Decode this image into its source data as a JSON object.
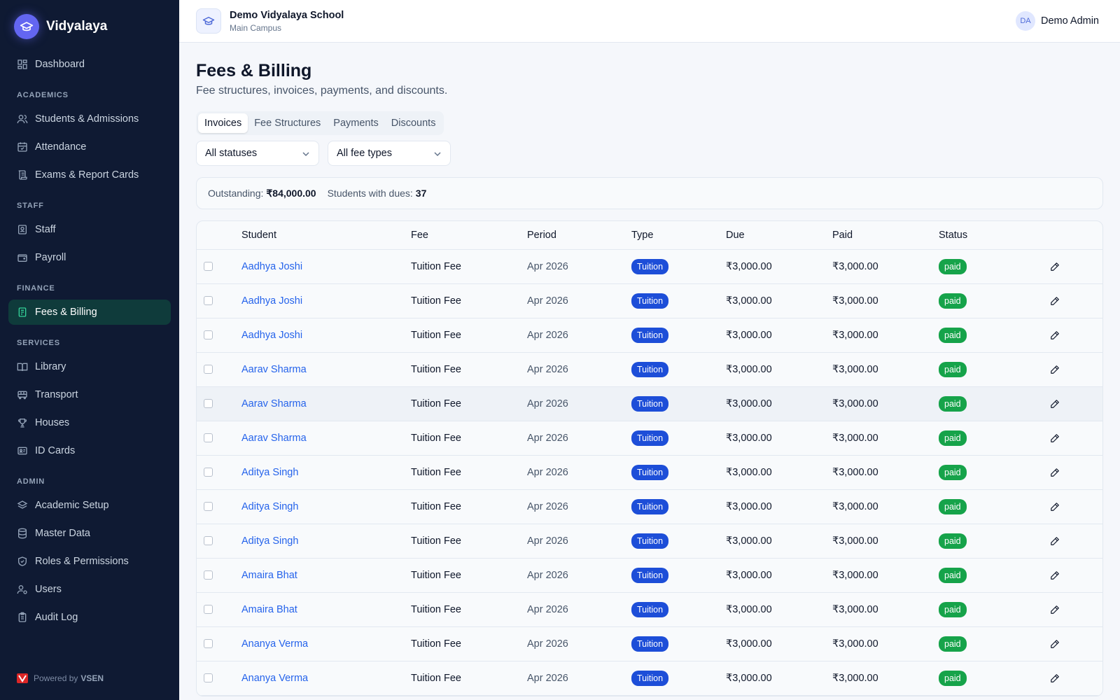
{
  "app": {
    "name": "Vidyalaya"
  },
  "sidebar": {
    "dashboard": "Dashboard",
    "sections": {
      "academics": "ACADEMICS",
      "staff": "STAFF",
      "finance": "FINANCE",
      "services": "SERVICES",
      "admin": "ADMIN"
    },
    "items": {
      "students": "Students & Admissions",
      "attendance": "Attendance",
      "exams": "Exams & Report Cards",
      "staff": "Staff",
      "payroll": "Payroll",
      "fees": "Fees & Billing",
      "library": "Library",
      "transport": "Transport",
      "houses": "Houses",
      "idcards": "ID Cards",
      "academic_setup": "Academic Setup",
      "master_data": "Master Data",
      "roles": "Roles & Permissions",
      "users": "Users",
      "audit": "Audit Log"
    },
    "active_item": "fees",
    "powered_prefix": "Powered by",
    "powered_brand": "VSEN"
  },
  "header": {
    "school_name": "Demo Vidyalaya School",
    "campus": "Main Campus",
    "user_initials": "DA",
    "user_name": "Demo Admin"
  },
  "page": {
    "title": "Fees & Billing",
    "subtitle": "Fee structures, invoices, payments, and discounts.",
    "tabs": [
      "Invoices",
      "Fee Structures",
      "Payments",
      "Discounts"
    ],
    "active_tab": "Invoices",
    "filters": {
      "status": "All statuses",
      "fee_type": "All fee types"
    },
    "summary": {
      "outstanding_label": "Outstanding:",
      "outstanding_value": "₹84,000.00",
      "dues_label": "Students with dues:",
      "dues_value": "37"
    }
  },
  "table": {
    "columns": [
      "Student",
      "Fee",
      "Period",
      "Type",
      "Due",
      "Paid",
      "Status"
    ],
    "rows": [
      {
        "student": "Aadhya Joshi",
        "fee": "Tuition Fee",
        "period": "Apr 2026",
        "type": "Tuition",
        "due": "₹3,000.00",
        "paid": "₹3,000.00",
        "status": "paid"
      },
      {
        "student": "Aadhya Joshi",
        "fee": "Tuition Fee",
        "period": "Apr 2026",
        "type": "Tuition",
        "due": "₹3,000.00",
        "paid": "₹3,000.00",
        "status": "paid"
      },
      {
        "student": "Aadhya Joshi",
        "fee": "Tuition Fee",
        "period": "Apr 2026",
        "type": "Tuition",
        "due": "₹3,000.00",
        "paid": "₹3,000.00",
        "status": "paid"
      },
      {
        "student": "Aarav Sharma",
        "fee": "Tuition Fee",
        "period": "Apr 2026",
        "type": "Tuition",
        "due": "₹3,000.00",
        "paid": "₹3,000.00",
        "status": "paid"
      },
      {
        "student": "Aarav Sharma",
        "fee": "Tuition Fee",
        "period": "Apr 2026",
        "type": "Tuition",
        "due": "₹3,000.00",
        "paid": "₹3,000.00",
        "status": "paid"
      },
      {
        "student": "Aarav Sharma",
        "fee": "Tuition Fee",
        "period": "Apr 2026",
        "type": "Tuition",
        "due": "₹3,000.00",
        "paid": "₹3,000.00",
        "status": "paid"
      },
      {
        "student": "Aditya Singh",
        "fee": "Tuition Fee",
        "period": "Apr 2026",
        "type": "Tuition",
        "due": "₹3,000.00",
        "paid": "₹3,000.00",
        "status": "paid"
      },
      {
        "student": "Aditya Singh",
        "fee": "Tuition Fee",
        "period": "Apr 2026",
        "type": "Tuition",
        "due": "₹3,000.00",
        "paid": "₹3,000.00",
        "status": "paid"
      },
      {
        "student": "Aditya Singh",
        "fee": "Tuition Fee",
        "period": "Apr 2026",
        "type": "Tuition",
        "due": "₹3,000.00",
        "paid": "₹3,000.00",
        "status": "paid"
      },
      {
        "student": "Amaira Bhat",
        "fee": "Tuition Fee",
        "period": "Apr 2026",
        "type": "Tuition",
        "due": "₹3,000.00",
        "paid": "₹3,000.00",
        "status": "paid"
      },
      {
        "student": "Amaira Bhat",
        "fee": "Tuition Fee",
        "period": "Apr 2026",
        "type": "Tuition",
        "due": "₹3,000.00",
        "paid": "₹3,000.00",
        "status": "paid"
      },
      {
        "student": "Ananya Verma",
        "fee": "Tuition Fee",
        "period": "Apr 2026",
        "type": "Tuition",
        "due": "₹3,000.00",
        "paid": "₹3,000.00",
        "status": "paid"
      },
      {
        "student": "Ananya Verma",
        "fee": "Tuition Fee",
        "period": "Apr 2026",
        "type": "Tuition",
        "due": "₹3,000.00",
        "paid": "₹3,000.00",
        "status": "paid"
      }
    ]
  },
  "colors": {
    "sidebar_bg": "#0f1a33",
    "active_nav_bg": "#0f3b3b",
    "link": "#2563eb",
    "type_badge": "#1d4ed8",
    "paid_badge": "#16a34a",
    "brand": "#6366f1"
  },
  "icons": {
    "brand": "graduation-cap-icon",
    "edit": "pencil-icon",
    "dropdown": "chevron-down-icon"
  }
}
